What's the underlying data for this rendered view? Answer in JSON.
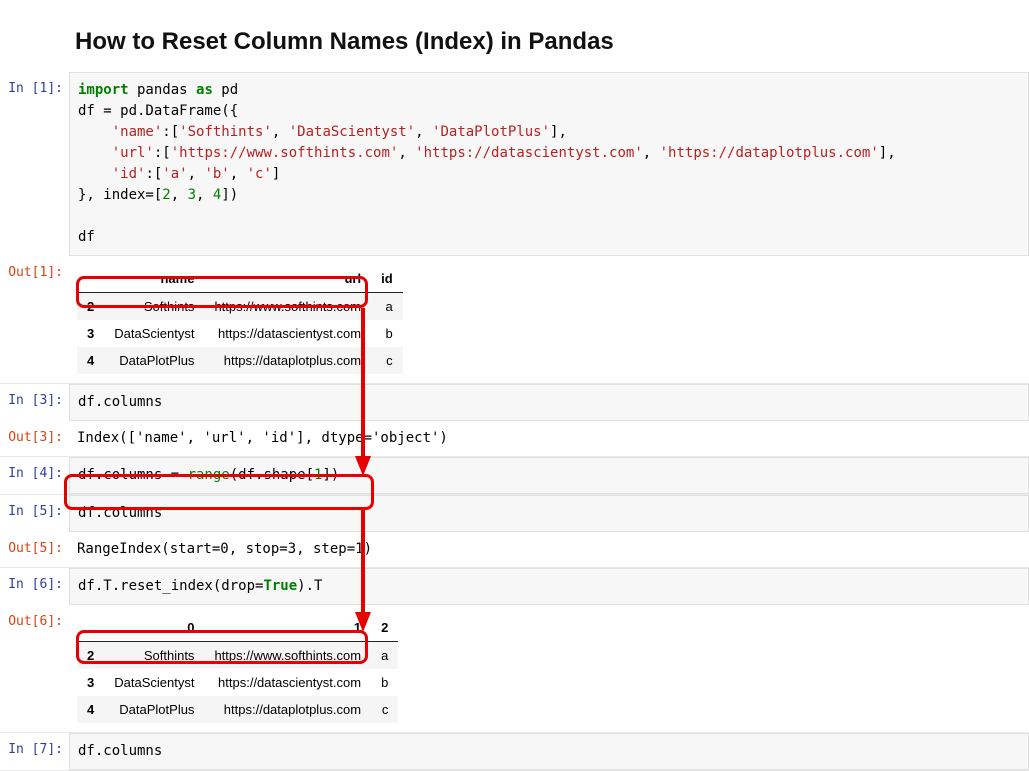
{
  "title": "How to Reset Column Names (Index) in Pandas",
  "cells": {
    "in1_prompt": "In [1]:",
    "out1_prompt": "Out[1]:",
    "in3_prompt": "In [3]:",
    "out3_prompt": "Out[3]:",
    "in4_prompt": "In [4]:",
    "in5_prompt": "In [5]:",
    "out5_prompt": "Out[5]:",
    "in6_prompt": "In [6]:",
    "out6_prompt": "Out[6]:",
    "in7_prompt": "In [7]:"
  },
  "code": {
    "in1": {
      "l1_import": "import",
      "l1_pandas": " pandas ",
      "l1_as": "as",
      "l1_pd": " pd",
      "l2_pre": "df = pd.DataFrame({",
      "l3_pre": "    ",
      "l3_k": "'name'",
      "l3_sep": ":[",
      "l3_v1": "'Softhints'",
      "l3_c1": ", ",
      "l3_v2": "'DataScientyst'",
      "l3_c2": ", ",
      "l3_v3": "'DataPlotPlus'",
      "l3_end": "],",
      "l4_pre": "    ",
      "l4_k": "'url'",
      "l4_sep": ":[",
      "l4_v1": "'https://www.softhints.com'",
      "l4_c1": ", ",
      "l4_v2": "'https://datascientyst.com'",
      "l4_c2": ", ",
      "l4_v3": "'https://dataplotplus.com'",
      "l4_end": "],",
      "l5_pre": "    ",
      "l5_k": "'id'",
      "l5_sep": ":[",
      "l5_v1": "'a'",
      "l5_c1": ", ",
      "l5_v2": "'b'",
      "l5_c2": ", ",
      "l5_v3": "'c'",
      "l5_end": "]",
      "l6_pre": "}, index=[",
      "l6_n1": "2",
      "l6_c1": ", ",
      "l6_n2": "3",
      "l6_c2": ", ",
      "l6_n3": "4",
      "l6_end": "])",
      "l7": "",
      "l8": "df"
    },
    "in3": "df.columns",
    "out3": "Index(['name', 'url', 'id'], dtype='object')",
    "in4_pre": "df.columns = ",
    "in4_range": "range",
    "in4_mid": "(df.shape[",
    "in4_one": "1",
    "in4_end": "])",
    "in5": "df.columns",
    "out5": "RangeIndex(start=0, stop=3, step=1)",
    "in6_pre": "df.T.reset_index(drop=",
    "in6_true": "True",
    "in6_end": ").T",
    "in7": "df.columns"
  },
  "table1": {
    "headers": [
      "",
      "name",
      "url",
      "id"
    ],
    "rows": [
      [
        "2",
        "Softhints",
        "https://www.softhints.com",
        "a"
      ],
      [
        "3",
        "DataScientyst",
        "https://datascientyst.com",
        "b"
      ],
      [
        "4",
        "DataPlotPlus",
        "https://dataplotplus.com",
        "c"
      ]
    ]
  },
  "table2": {
    "headers": [
      "",
      "0",
      "1",
      "2"
    ],
    "rows": [
      [
        "2",
        "Softhints",
        "https://www.softhints.com",
        "a"
      ],
      [
        "3",
        "DataScientyst",
        "https://datascientyst.com",
        "b"
      ],
      [
        "4",
        "DataPlotPlus",
        "https://dataplotplus.com",
        "c"
      ]
    ]
  }
}
